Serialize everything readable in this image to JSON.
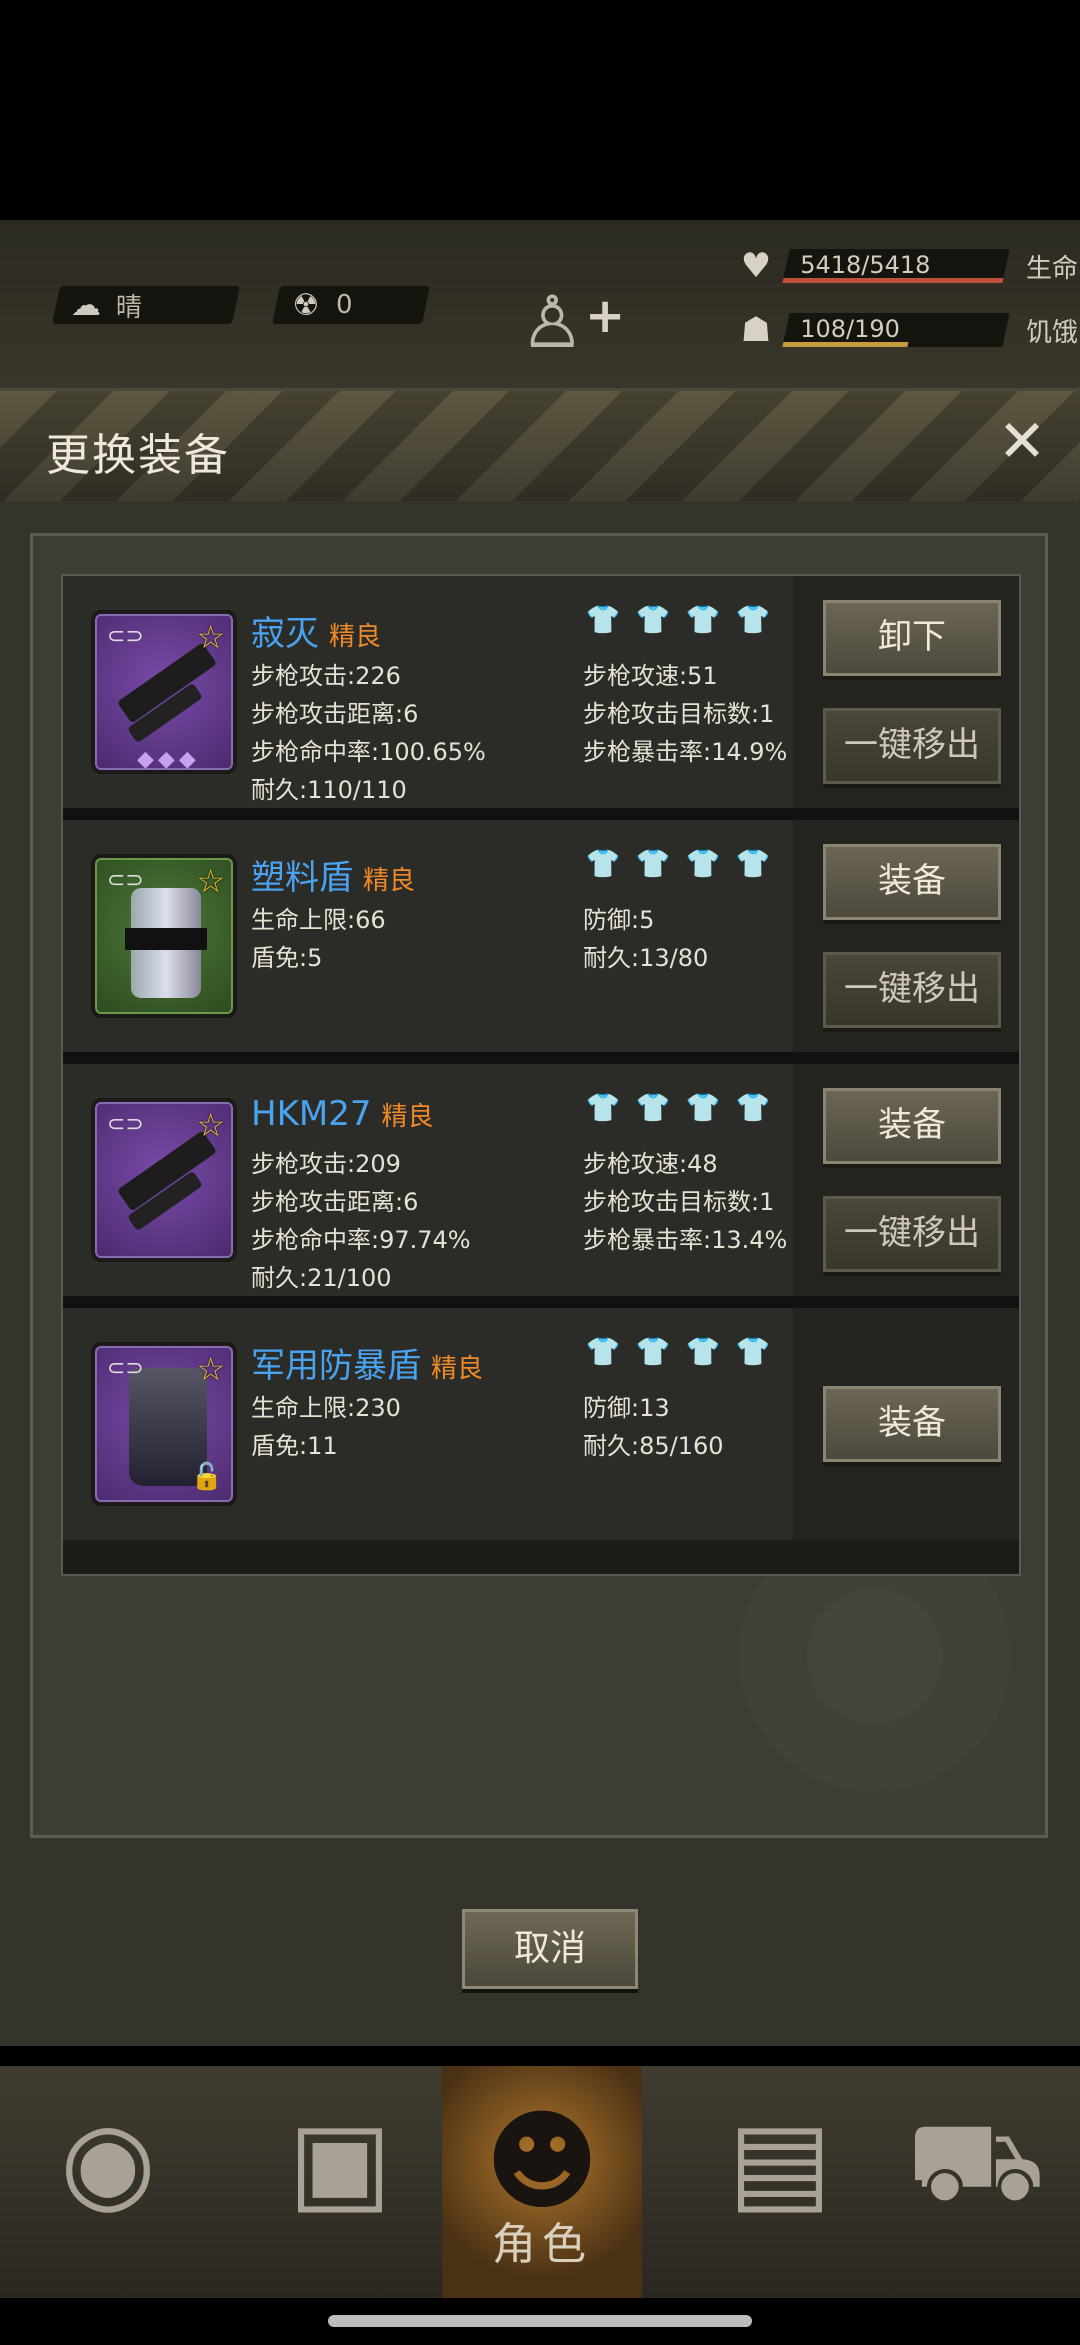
{
  "status": {
    "weather_icon": "cloud-sun-icon",
    "weather": "晴",
    "radiation_icon": "radiation-icon",
    "radiation": "0",
    "health": {
      "value": "5418/5418",
      "label": "生命",
      "fill": 1.0,
      "color": "#c0503a"
    },
    "hunger": {
      "value": "108/190",
      "label": "饥饿",
      "fill": 0.57,
      "color": "#c89a40"
    }
  },
  "modal": {
    "title": "更换装备",
    "close_icon": "close-icon",
    "cancel_label": "取消"
  },
  "items": [
    {
      "name": "寂灭",
      "quality": "精良",
      "icon": "rifle-icon",
      "slots": [
        false,
        false,
        true,
        false
      ],
      "stats_left": [
        "步枪攻击:226",
        "步枪攻击距离:6",
        "步枪命中率:100.65%",
        "耐久:110/110"
      ],
      "stats_right": [
        "步枪攻速:51",
        "步枪攻击目标数:1",
        "步枪暴击率:14.9%"
      ],
      "buttons": [
        "卸下",
        "一键移出"
      ],
      "gems": "◆◆◆"
    },
    {
      "name": "塑料盾",
      "quality": "精良",
      "icon": "shield-icon",
      "slots": [
        true,
        false,
        false,
        false
      ],
      "stats_left": [
        "生命上限:66",
        "盾免:5"
      ],
      "stats_right": [
        "防御:5",
        "耐久:13/80"
      ],
      "buttons": [
        "装备",
        "一键移出"
      ]
    },
    {
      "name": "HKM27",
      "quality": "精良",
      "icon": "rifle-icon",
      "slots": [
        false,
        true,
        false,
        false
      ],
      "stats_left": [
        "步枪攻击:209",
        "步枪攻击距离:6",
        "步枪命中率:97.74%",
        "耐久:21/100"
      ],
      "stats_right": [
        "步枪攻速:48",
        "步枪攻击目标数:1",
        "步枪暴击率:13.4%"
      ],
      "buttons": [
        "装备",
        "一键移出"
      ]
    },
    {
      "name": "军用防暴盾",
      "quality": "精良",
      "icon": "riot-shield-icon",
      "slots": [
        false,
        false,
        false,
        false
      ],
      "stats_left": [
        "生命上限:230",
        "盾免:11"
      ],
      "stats_right": [
        "防御:13",
        "耐久:85/160"
      ],
      "buttons": [
        "装备"
      ]
    }
  ],
  "slot_icons": [
    "I",
    "II",
    "III",
    "IV"
  ],
  "nav": [
    {
      "icon": "globe-icon",
      "label": ""
    },
    {
      "icon": "backpack-icon",
      "label": ""
    },
    {
      "icon": "character-icon",
      "label": "角色",
      "active": true
    },
    {
      "icon": "radio-icon",
      "label": ""
    },
    {
      "icon": "cart-icon",
      "label": ""
    }
  ]
}
